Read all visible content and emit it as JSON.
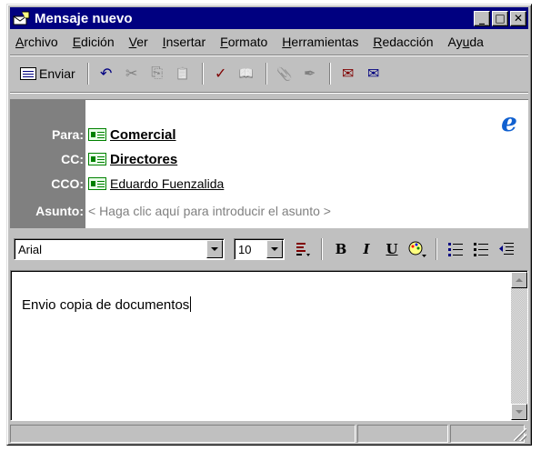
{
  "window": {
    "title": "Mensaje nuevo",
    "controls": {
      "minimize": "_",
      "maximize": "□",
      "close": "✕"
    }
  },
  "menu": [
    {
      "pre": "",
      "key": "A",
      "rest": "rchivo"
    },
    {
      "pre": "",
      "key": "E",
      "rest": "dición"
    },
    {
      "pre": "",
      "key": "V",
      "rest": "er"
    },
    {
      "pre": "",
      "key": "I",
      "rest": "nsertar"
    },
    {
      "pre": "",
      "key": "F",
      "rest": "ormato"
    },
    {
      "pre": "",
      "key": "H",
      "rest": "erramientas"
    },
    {
      "pre": "",
      "key": "R",
      "rest": "edacción"
    },
    {
      "pre": "Ay",
      "key": "u",
      "rest": "da"
    }
  ],
  "toolbar": {
    "send_label": "Enviar",
    "icons": {
      "undo": "↶",
      "cut": "✂",
      "copy": "⎘",
      "paste": "📋",
      "check_names": "✓",
      "address_book": "📖",
      "attach": "📎",
      "sign": "✒",
      "priority": "✉",
      "encrypt": "✉"
    }
  },
  "header": {
    "to_label": "Para:",
    "to_value": "Comercial",
    "cc_label": "CC:",
    "cc_value": "Directores",
    "bcc_label": "CCO:",
    "bcc_value": "Eduardo Fuenzalida",
    "subject_label": "Asunto:",
    "subject_placeholder": "< Haga clic aquí para introducir el asunto >",
    "logo": "e"
  },
  "format": {
    "font": "Arial",
    "size": "10",
    "bold": "B",
    "italic": "I",
    "underline": "U"
  },
  "body": {
    "text": "Envio copia de documentos"
  },
  "colors": {
    "titlebar": "#000080",
    "chrome": "#c0c0c0",
    "header_label_bg": "#808080",
    "logo": "#1060d0"
  }
}
